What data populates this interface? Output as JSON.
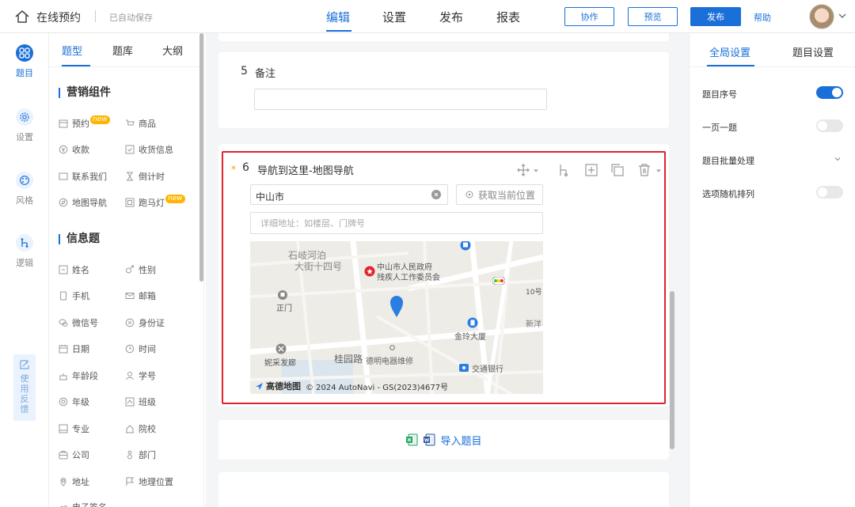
{
  "header": {
    "app_title": "在线预约",
    "autosave": "已自动保存",
    "tabs": [
      {
        "label": "编辑",
        "active": true
      },
      {
        "label": "设置",
        "active": false
      },
      {
        "label": "发布",
        "active": false
      },
      {
        "label": "报表",
        "active": false
      }
    ],
    "collab_label": "协作",
    "preview_label": "预览",
    "publish_label": "发布",
    "help_label": "帮助"
  },
  "rail": {
    "items": [
      {
        "label": "题目",
        "icon": "grid-icon",
        "active": true
      },
      {
        "label": "设置",
        "icon": "gear-icon",
        "active": false
      },
      {
        "label": "风格",
        "icon": "palette-icon",
        "active": false
      },
      {
        "label": "逻辑",
        "icon": "logic-icon",
        "active": false
      }
    ],
    "feedback_label": "使用反馈"
  },
  "panel": {
    "tabs": [
      {
        "label": "题型",
        "active": true
      },
      {
        "label": "题库",
        "active": false
      },
      {
        "label": "大纲",
        "active": false
      }
    ],
    "new_badge": "new",
    "sections": [
      {
        "title": "营销组件",
        "items": [
          {
            "label": "预约",
            "icon": "calendar-icon",
            "new": true
          },
          {
            "label": "商品",
            "icon": "cart-icon",
            "new": false
          },
          {
            "label": "收款",
            "icon": "money-icon",
            "new": false
          },
          {
            "label": "收货信息",
            "icon": "check-box-icon",
            "new": false
          },
          {
            "label": "联系我们",
            "icon": "contact-icon",
            "new": false
          },
          {
            "label": "倒计时",
            "icon": "hourglass-icon",
            "new": false
          },
          {
            "label": "地图导航",
            "icon": "compass-icon",
            "new": false
          },
          {
            "label": "跑马灯",
            "icon": "marquee-icon",
            "new": true
          }
        ]
      },
      {
        "title": "信息题",
        "items": [
          {
            "label": "姓名",
            "icon": "id-icon"
          },
          {
            "label": "性别",
            "icon": "gender-icon"
          },
          {
            "label": "手机",
            "icon": "phone-icon"
          },
          {
            "label": "邮箱",
            "icon": "mail-icon"
          },
          {
            "label": "微信号",
            "icon": "wechat-icon"
          },
          {
            "label": "身份证",
            "icon": "id-card-icon"
          },
          {
            "label": "日期",
            "icon": "date-icon"
          },
          {
            "label": "时间",
            "icon": "clock-icon"
          },
          {
            "label": "年龄段",
            "icon": "age-icon"
          },
          {
            "label": "学号",
            "icon": "student-icon"
          },
          {
            "label": "年级",
            "icon": "grade-icon"
          },
          {
            "label": "班级",
            "icon": "class-icon"
          },
          {
            "label": "专业",
            "icon": "major-icon"
          },
          {
            "label": "院校",
            "icon": "school-icon"
          },
          {
            "label": "公司",
            "icon": "company-icon"
          },
          {
            "label": "部门",
            "icon": "department-icon"
          },
          {
            "label": "地址",
            "icon": "location-icon"
          },
          {
            "label": "地理位置",
            "icon": "flag-icon"
          },
          {
            "label": "电子签名",
            "icon": "sign-icon"
          }
        ]
      }
    ]
  },
  "canvas": {
    "q5": {
      "number": "5",
      "label": "备注"
    },
    "q6": {
      "required_mark": "*",
      "number": "6",
      "label": "导航到这里-地图导航",
      "city_value": "中山市",
      "locate_label": "获取当前位置",
      "address_placeholder": "详细地址：如楼层、门牌号",
      "map": {
        "labels": [
          "石岐河泊",
          "大街十四号",
          "中山市人民政府",
          "残疾人工作委员会",
          "正门",
          "金玲大厦",
          "新洋",
          "10号",
          "妮采发廊",
          "桂园路",
          "德明电器维修",
          "交通银行"
        ],
        "brand": "高德地图",
        "copyright": "© 2024 AutoNavi - GS(2023)4677号"
      }
    },
    "import_label": "导入题目"
  },
  "right": {
    "tabs": [
      {
        "label": "全局设置",
        "active": true
      },
      {
        "label": "题目设置",
        "active": false
      }
    ],
    "settings": [
      {
        "label": "题目序号",
        "type": "toggle",
        "on": true
      },
      {
        "label": "一页一题",
        "type": "toggle",
        "on": false
      },
      {
        "label": "题目批量处理",
        "type": "expand"
      },
      {
        "label": "选项随机排列",
        "type": "toggle",
        "on": false
      }
    ]
  },
  "colors": {
    "accent": "#1a6fd8",
    "highlight_border": "#e0232c",
    "badge": "#ffb400"
  }
}
